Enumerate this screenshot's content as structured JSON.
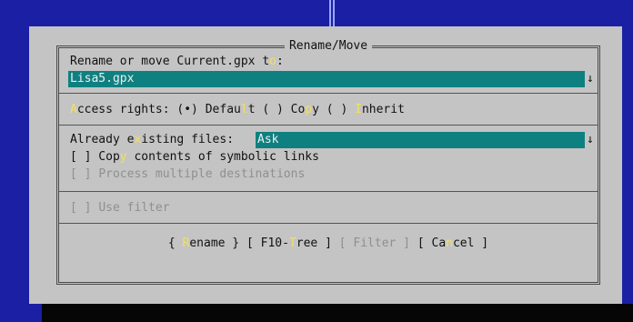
{
  "dialog": {
    "title": "Rename/Move",
    "prompt": "Rename or move Current.gpx to:",
    "target_value": "Lisa5.gpx",
    "access_rights": {
      "label": "Access rights:",
      "options": [
        {
          "mark": "(•)",
          "label": "Default"
        },
        {
          "mark": "( )",
          "label": "Copy"
        },
        {
          "mark": "( )",
          "label": "Inherit"
        }
      ]
    },
    "existing_files": {
      "label": "Already existing files:",
      "value": "Ask"
    },
    "copy_symlinks": {
      "mark": "[ ]",
      "label": "Copy contents of symbolic links"
    },
    "multiple_destinations": {
      "mark": "[ ]",
      "label": "Process multiple destinations"
    },
    "use_filter": {
      "mark": "[ ]",
      "label": "Use filter"
    },
    "buttons": {
      "rename": "{ Rename }",
      "tree": "[ F10-Tree ]",
      "filter": "[ Filter ]",
      "cancel": "[ Cancel ]"
    },
    "dropdown_arrow": "↓"
  },
  "colors": {
    "background_blue": "#1b1fa3",
    "dialog_gray": "#c4c4c4",
    "input_teal": "#0f8080",
    "hotkey_yellow": "#f3df62"
  }
}
